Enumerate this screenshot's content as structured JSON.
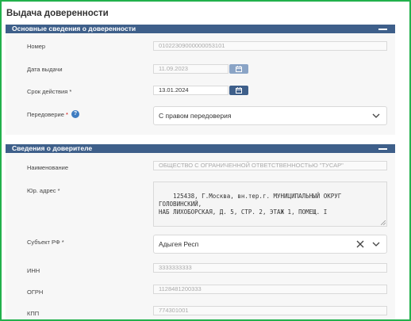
{
  "page": {
    "title": "Выдача доверенности"
  },
  "section1": {
    "title": "Основные сведения о доверенности",
    "number": {
      "label": "Номер",
      "value": "01022309000000053101"
    },
    "issue_date": {
      "label": "Дата выдачи",
      "value": "11.09.2023"
    },
    "validity": {
      "label": "Срок действия *",
      "value": "13.01.2024"
    },
    "delegation": {
      "label": "Передоверие",
      "required": "*",
      "help": "?",
      "value": "С правом передоверия"
    }
  },
  "section2": {
    "title": "Сведения о доверителе",
    "name": {
      "label": "Наименование",
      "value": "ОБЩЕСТВО С ОГРАНИЧЕННОЙ ОТВЕТСТВЕННОСТЬЮ \"ТУСАР\""
    },
    "address": {
      "label": "Юр. адрес *",
      "value": "125438, Г.Москва, вн.тер.г. МУНИЦИПАЛЬНЫЙ ОКРУГ ГОЛОВИНСКИЙ,\nНАБ ЛИХОБОРСКАЯ, Д. 5, СТР. 2, ЭТАЖ 1, ПОМЕЩ. I"
    },
    "region": {
      "label": "Субъект РФ *",
      "value": "Адыгея Респ"
    },
    "inn": {
      "label": "ИНН",
      "value": "3333333333"
    },
    "ogrn": {
      "label": "ОГРН",
      "value": "1128481200333"
    },
    "kpp": {
      "label": "КПП",
      "value": "774301001"
    }
  },
  "colors": {
    "header": "#3e5f8a",
    "frame": "#22b14c",
    "help": "#3e7cc1"
  },
  "icons": [
    "calendar-icon",
    "chevron-down-icon",
    "close-icon",
    "help-icon",
    "collapse-icon"
  ]
}
